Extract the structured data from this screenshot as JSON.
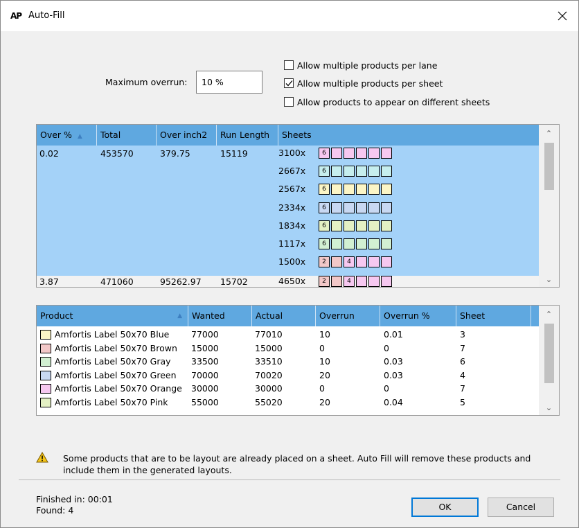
{
  "window": {
    "title": "Auto-Fill",
    "app_icon_text": "AP"
  },
  "options": {
    "max_overrun_label": "Maximum overrun:",
    "max_overrun_value": "10 %",
    "checkboxes": [
      {
        "label": "Allow multiple products per lane",
        "checked": false
      },
      {
        "label": "Allow multiple products per sheet",
        "checked": true
      },
      {
        "label": "Allow products to appear on different sheets",
        "checked": false
      }
    ]
  },
  "layouts": {
    "columns": [
      "Over %",
      "Total",
      "Over inch2",
      "Run Length",
      "Sheets"
    ],
    "rows": [
      {
        "over_pct": "0.02",
        "total": "453570",
        "over_inch2": "379.75",
        "run_length": "15119",
        "sheets": [
          {
            "count": "3100x",
            "cells": [
              {
                "label": "6",
                "color": "#f6c8f0"
              },
              {
                "label": "",
                "color": "#f6c8f0"
              },
              {
                "label": "",
                "color": "#f6c8f0"
              },
              {
                "label": "",
                "color": "#f6c8f0"
              },
              {
                "label": "",
                "color": "#f6c8f0"
              },
              {
                "label": "",
                "color": "#f6c8f0"
              }
            ]
          },
          {
            "count": "2667x",
            "cells": [
              {
                "label": "6",
                "color": "#c6eeee"
              },
              {
                "label": "",
                "color": "#c6eeee"
              },
              {
                "label": "",
                "color": "#c6eeee"
              },
              {
                "label": "",
                "color": "#c6eeee"
              },
              {
                "label": "",
                "color": "#c6eeee"
              },
              {
                "label": "",
                "color": "#c6eeee"
              }
            ]
          },
          {
            "count": "2567x",
            "cells": [
              {
                "label": "6",
                "color": "#fbf5c6"
              },
              {
                "label": "",
                "color": "#fbf5c6"
              },
              {
                "label": "",
                "color": "#fbf5c6"
              },
              {
                "label": "",
                "color": "#fbf5c6"
              },
              {
                "label": "",
                "color": "#fbf5c6"
              },
              {
                "label": "",
                "color": "#fbf5c6"
              }
            ]
          },
          {
            "count": "2334x",
            "cells": [
              {
                "label": "6",
                "color": "#c8d8f2"
              },
              {
                "label": "",
                "color": "#c8d8f2"
              },
              {
                "label": "",
                "color": "#c8d8f2"
              },
              {
                "label": "",
                "color": "#c8d8f2"
              },
              {
                "label": "",
                "color": "#c8d8f2"
              },
              {
                "label": "",
                "color": "#c8d8f2"
              }
            ]
          },
          {
            "count": "1834x",
            "cells": [
              {
                "label": "6",
                "color": "#e4f0c4"
              },
              {
                "label": "",
                "color": "#e4f0c4"
              },
              {
                "label": "",
                "color": "#e4f0c4"
              },
              {
                "label": "",
                "color": "#e4f0c4"
              },
              {
                "label": "",
                "color": "#e4f0c4"
              },
              {
                "label": "",
                "color": "#e4f0c4"
              }
            ]
          },
          {
            "count": "1117x",
            "cells": [
              {
                "label": "6",
                "color": "#d2f0d2"
              },
              {
                "label": "",
                "color": "#d2f0d2"
              },
              {
                "label": "",
                "color": "#d2f0d2"
              },
              {
                "label": "",
                "color": "#d2f0d2"
              },
              {
                "label": "",
                "color": "#d2f0d2"
              },
              {
                "label": "",
                "color": "#d2f0d2"
              }
            ]
          },
          {
            "count": "1500x",
            "cells": [
              {
                "label": "2",
                "color": "#f2c8c8"
              },
              {
                "label": "",
                "color": "#f2c8c8"
              },
              {
                "label": "4",
                "color": "#f6c8f0"
              },
              {
                "label": "",
                "color": "#f6c8f0"
              },
              {
                "label": "",
                "color": "#f6c8f0"
              },
              {
                "label": "",
                "color": "#f6c8f0"
              }
            ]
          }
        ]
      },
      {
        "over_pct": "3.87",
        "total": "471060",
        "over_inch2": "95262.97",
        "run_length": "15702",
        "sheets": [
          {
            "count": "4650x",
            "cells": [
              {
                "label": "2",
                "color": "#f2c8c8"
              },
              {
                "label": "",
                "color": "#f2c8c8"
              },
              {
                "label": "4",
                "color": "#f6c8f0"
              },
              {
                "label": "",
                "color": "#f6c8f0"
              },
              {
                "label": "",
                "color": "#f6c8f0"
              },
              {
                "label": "",
                "color": "#f6c8f0"
              }
            ]
          }
        ]
      }
    ]
  },
  "products": {
    "columns": [
      "Product",
      "Wanted",
      "Actual",
      "Overrun",
      "Overrun %",
      "Sheet"
    ],
    "rows": [
      {
        "swatch": "#fbf5c6",
        "name": "Amfortis Label 50x70 Blue",
        "wanted": "77000",
        "actual": "77010",
        "overrun": "10",
        "overrun_pct": "0.01",
        "sheet": "3"
      },
      {
        "swatch": "#f2c8c8",
        "name": "Amfortis Label 50x70 Brown",
        "wanted": "15000",
        "actual": "15000",
        "overrun": "0",
        "overrun_pct": "0",
        "sheet": "7"
      },
      {
        "swatch": "#d2f0d2",
        "name": "Amfortis Label 50x70 Gray",
        "wanted": "33500",
        "actual": "33510",
        "overrun": "10",
        "overrun_pct": "0.03",
        "sheet": "6"
      },
      {
        "swatch": "#c8d8f2",
        "name": "Amfortis Label 50x70 Green",
        "wanted": "70000",
        "actual": "70020",
        "overrun": "20",
        "overrun_pct": "0.03",
        "sheet": "4"
      },
      {
        "swatch": "#f6c8f0",
        "name": "Amfortis Label 50x70 Orange",
        "wanted": "30000",
        "actual": "30000",
        "overrun": "0",
        "overrun_pct": "0",
        "sheet": "7"
      },
      {
        "swatch": "#e4f0c4",
        "name": "Amfortis Label 50x70 Pink",
        "wanted": "55000",
        "actual": "55020",
        "overrun": "20",
        "overrun_pct": "0.04",
        "sheet": "5"
      }
    ]
  },
  "warning": {
    "icon": "warning-icon",
    "line1": "Some products that are to be layout are already placed on a sheet. Auto Fill will remove these products and",
    "line2": "include them in the generated layouts."
  },
  "status": {
    "finished": "Finished in: 00:01",
    "found": "Found: 4"
  },
  "buttons": {
    "ok": "OK",
    "cancel": "Cancel"
  },
  "colors": {
    "header_bg": "#5fa8e0",
    "selected_row": "#a4d2f8",
    "accent": "#0078d7"
  }
}
